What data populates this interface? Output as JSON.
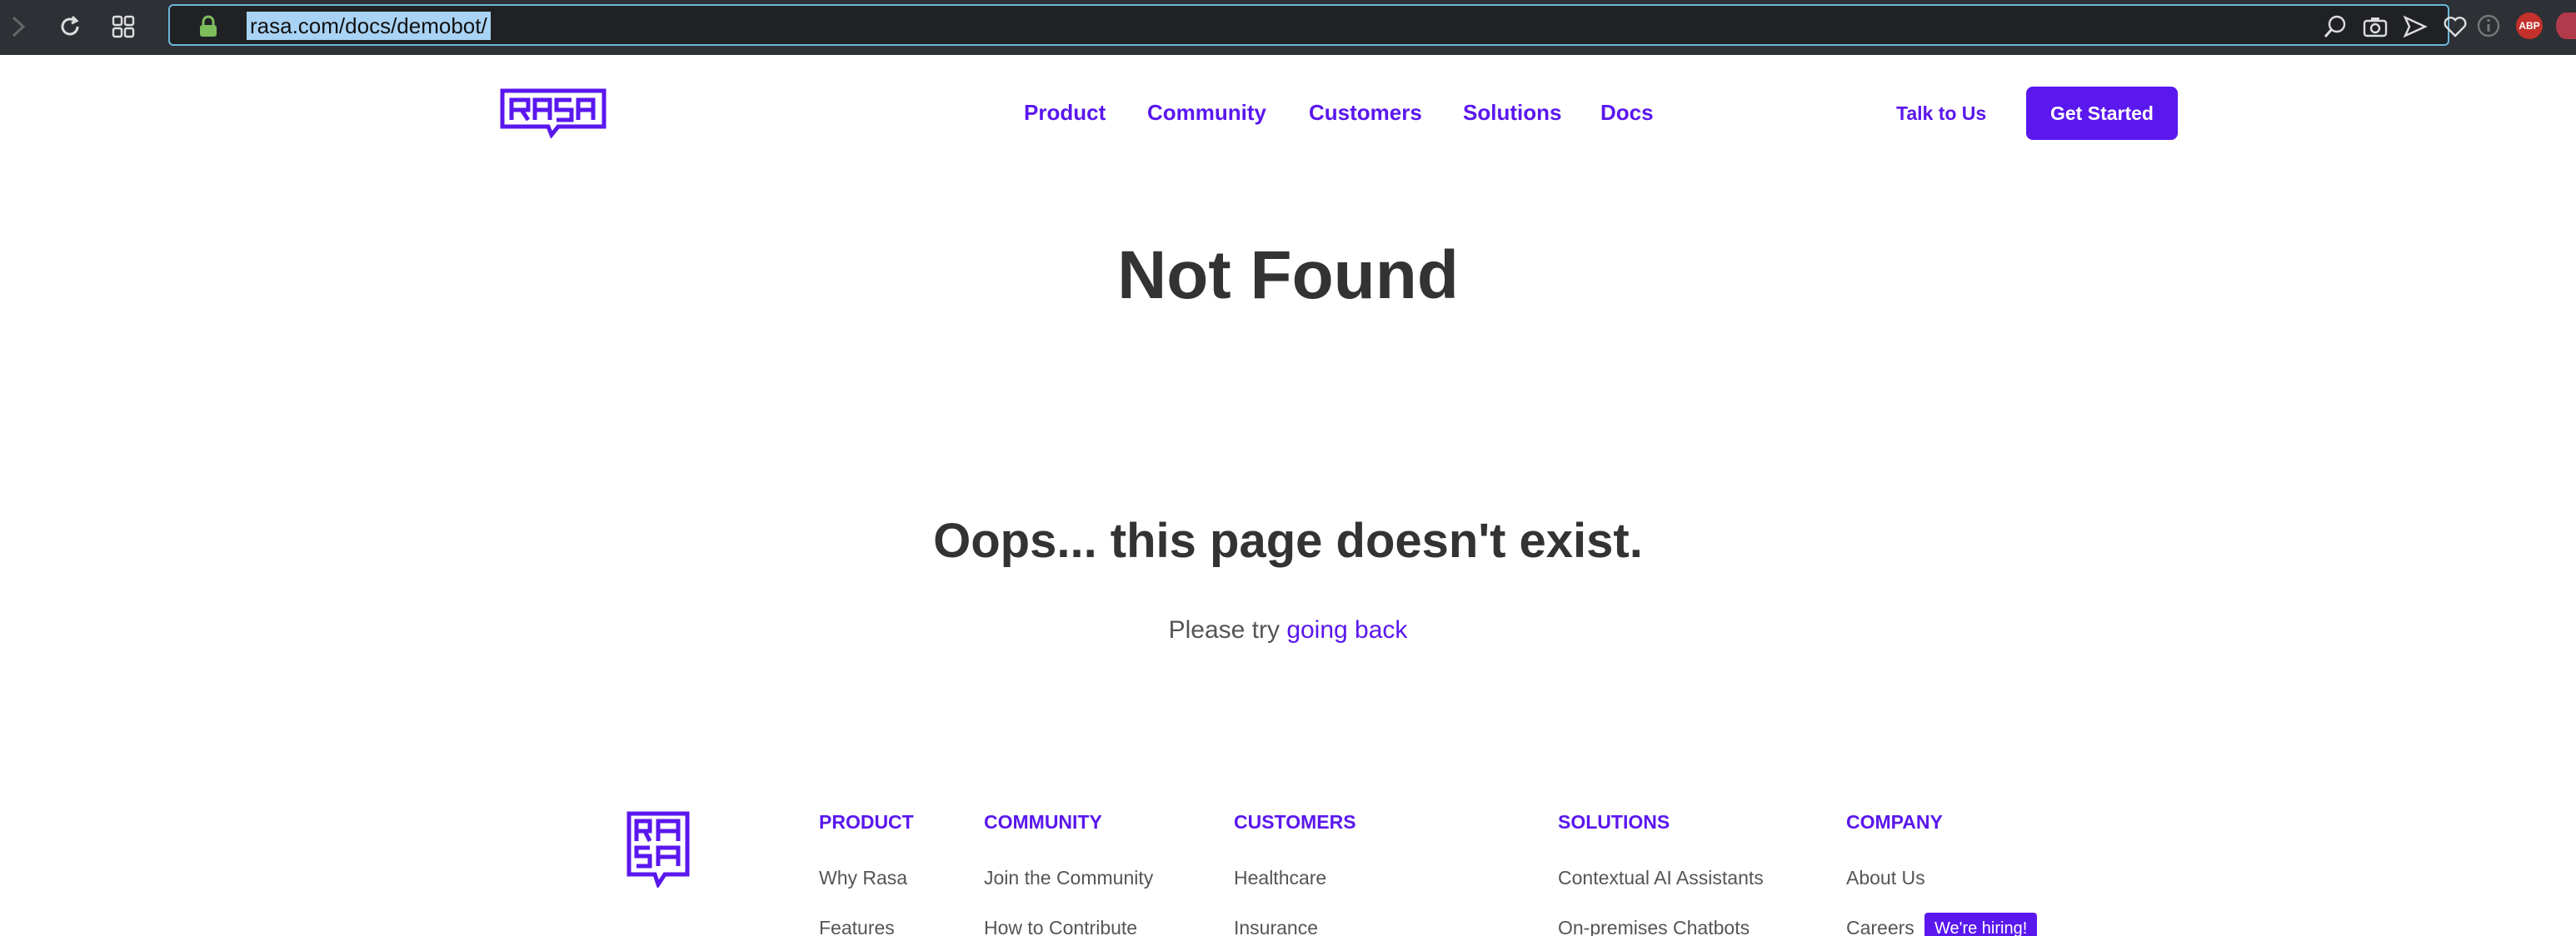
{
  "browser": {
    "url": "rasa.com/docs/demobot/",
    "extensions": [
      "ABP"
    ]
  },
  "header": {
    "nav": [
      "Product",
      "Community",
      "Customers",
      "Solutions",
      "Docs"
    ],
    "talk_label": "Talk to Us",
    "cta_label": "Get Started"
  },
  "main": {
    "title": "Not Found",
    "message": "Oops... this page doesn't exist.",
    "retry_prefix": "Please try",
    "retry_link": "going back"
  },
  "footer": {
    "columns": [
      {
        "heading": "PRODUCT",
        "links": [
          "Why Rasa",
          "Features"
        ]
      },
      {
        "heading": "COMMUNITY",
        "links": [
          "Join the Community",
          "How to Contribute"
        ]
      },
      {
        "heading": "CUSTOMERS",
        "links": [
          "Healthcare",
          "Insurance"
        ]
      },
      {
        "heading": "SOLUTIONS",
        "links": [
          "Contextual AI Assistants",
          "On-premises Chatbots"
        ]
      },
      {
        "heading": "COMPANY",
        "links": [
          "About Us",
          "Careers"
        ]
      }
    ],
    "hiring_badge": "We're hiring!"
  },
  "colors": {
    "brand": "#5a17ee",
    "chrome": "#2d3035",
    "text_dark": "#333333"
  },
  "icons": [
    "back-icon",
    "reload-icon",
    "grid-icon",
    "lock-icon",
    "zoom-icon",
    "camera-icon",
    "send-icon",
    "heart-icon",
    "info-icon"
  ]
}
